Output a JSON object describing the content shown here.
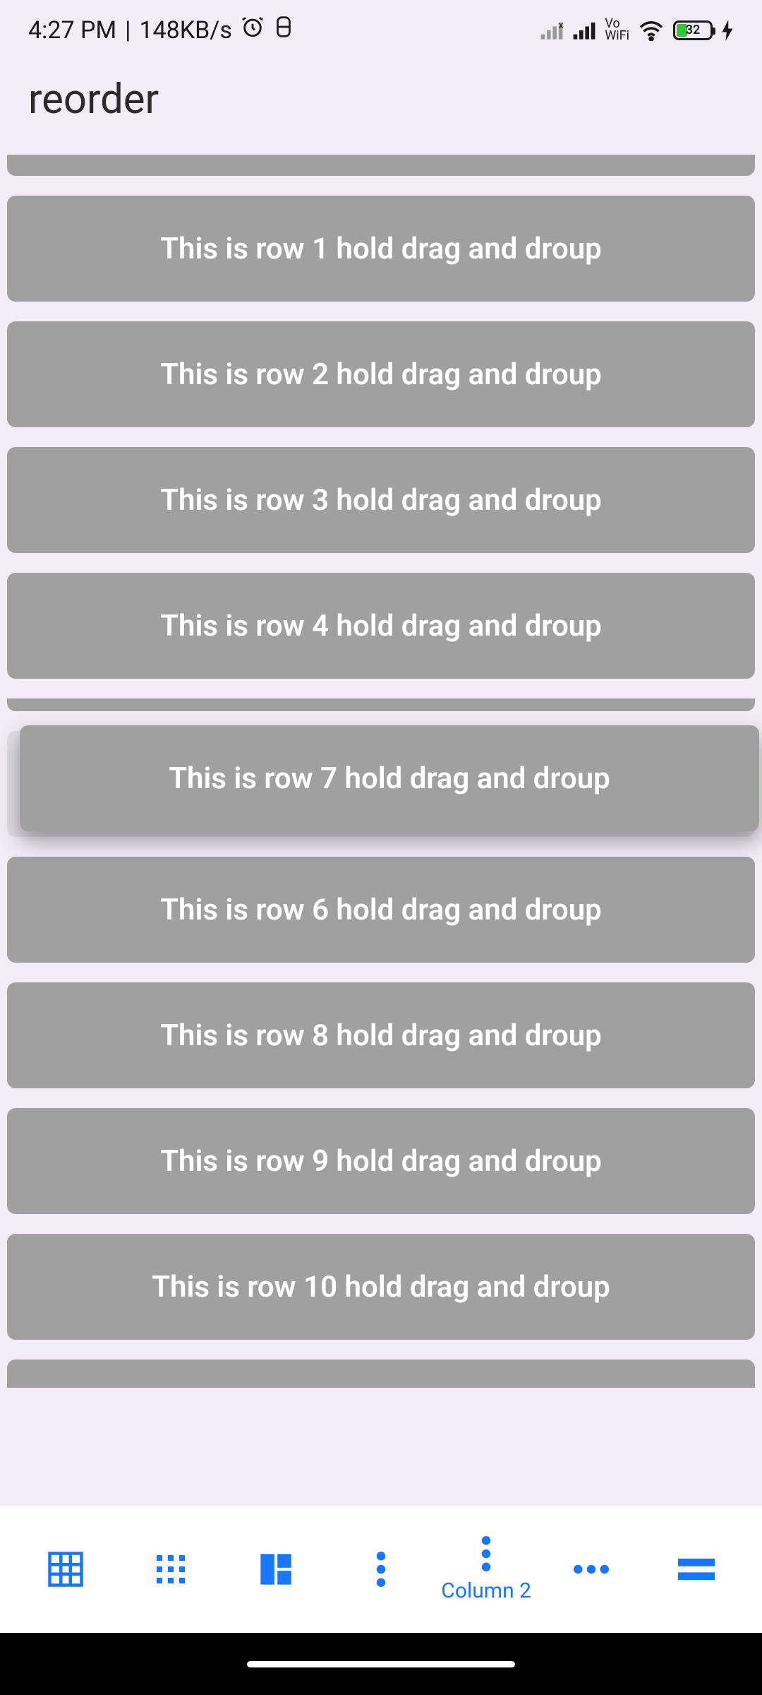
{
  "status": {
    "time": "4:27 PM",
    "sep": " | ",
    "net_speed": "148KB/s",
    "vo": "Vo",
    "wifi": "WiFi",
    "battery_pct": "32"
  },
  "appbar": {
    "title": "reorder"
  },
  "rows": {
    "r1": "This is row 1 hold drag and droup",
    "r2": "This is row 2 hold drag and droup",
    "r3": "This is row 3 hold drag and droup",
    "r4": "This is row 4 hold drag and droup",
    "r6": "This is row 6 hold drag and droup",
    "r7": "This is row 7 hold drag and droup",
    "r7_ghost": "This is row 7 hold drag and droup",
    "r8": "This is row 8 hold drag and droup",
    "r9": "This is row 9 hold drag and droup",
    "r10": "This is row 10 hold drag and droup"
  },
  "nav": {
    "active_label": "Column 2"
  }
}
